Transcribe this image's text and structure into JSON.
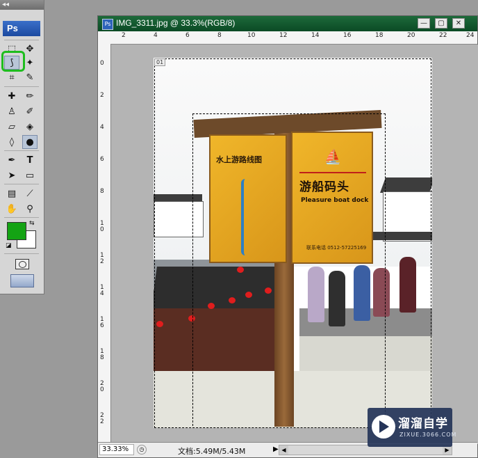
{
  "toolbox": {
    "grip": "◂◂",
    "logo": "Ps",
    "foreground_color": "#14a314",
    "background_color": "#ffffff",
    "selected_tool": "magnetic-lasso",
    "tools": [
      {
        "name": "marquee-tool",
        "glyph": "⬚"
      },
      {
        "name": "move-tool",
        "glyph": "✥"
      },
      {
        "name": "magnetic-lasso-tool",
        "glyph": "⟆"
      },
      {
        "name": "magic-wand-tool",
        "glyph": "✦"
      },
      {
        "name": "crop-tool",
        "glyph": "⌗"
      },
      {
        "name": "slice-tool",
        "glyph": "✎"
      },
      {
        "name": "healing-brush-tool",
        "glyph": "✚"
      },
      {
        "name": "brush-tool",
        "glyph": "✏"
      },
      {
        "name": "clone-stamp-tool",
        "glyph": "♙"
      },
      {
        "name": "history-brush-tool",
        "glyph": "✐"
      },
      {
        "name": "eraser-tool",
        "glyph": "▱"
      },
      {
        "name": "paint-bucket-tool",
        "glyph": "◈"
      },
      {
        "name": "blur-tool",
        "glyph": "💧"
      },
      {
        "name": "dodge-tool",
        "glyph": "●"
      },
      {
        "name": "pen-tool",
        "glyph": "✒"
      },
      {
        "name": "type-tool",
        "glyph": "T"
      },
      {
        "name": "path-selection-tool",
        "glyph": "➤"
      },
      {
        "name": "rectangle-tool",
        "glyph": "▭"
      },
      {
        "name": "notes-tool",
        "glyph": "▤"
      },
      {
        "name": "eyedropper-tool",
        "glyph": "⟋"
      },
      {
        "name": "hand-tool",
        "glyph": "✋"
      },
      {
        "name": "zoom-tool",
        "glyph": "🔍"
      }
    ]
  },
  "document": {
    "title": "IMG_3311.jpg @ 33.3%(RGB/8)",
    "buttons": {
      "minimize": "—",
      "maximize": "▢",
      "close": "✕"
    },
    "ruler_top": [
      "2",
      "4",
      "6",
      "8",
      "10",
      "12",
      "14",
      "16",
      "18",
      "20",
      "22",
      "24"
    ],
    "ruler_left": [
      "0",
      "2",
      "4",
      "6",
      "8",
      "10",
      "12",
      "14",
      "16",
      "18",
      "20",
      "22"
    ],
    "layer_tag": "01"
  },
  "sign": {
    "left_title": "水上游路线图",
    "right_title": "游船码头",
    "right_subtitle": "Pleasure boat dock",
    "phone": "联系电话 0512-57225169"
  },
  "statusbar": {
    "zoom": "33.33%",
    "doc_info": "文档:5.49M/5.43M",
    "arrow": "▶"
  },
  "watermark": {
    "cn": "溜溜自学",
    "en": "ZIXUE.3066.COM"
  }
}
